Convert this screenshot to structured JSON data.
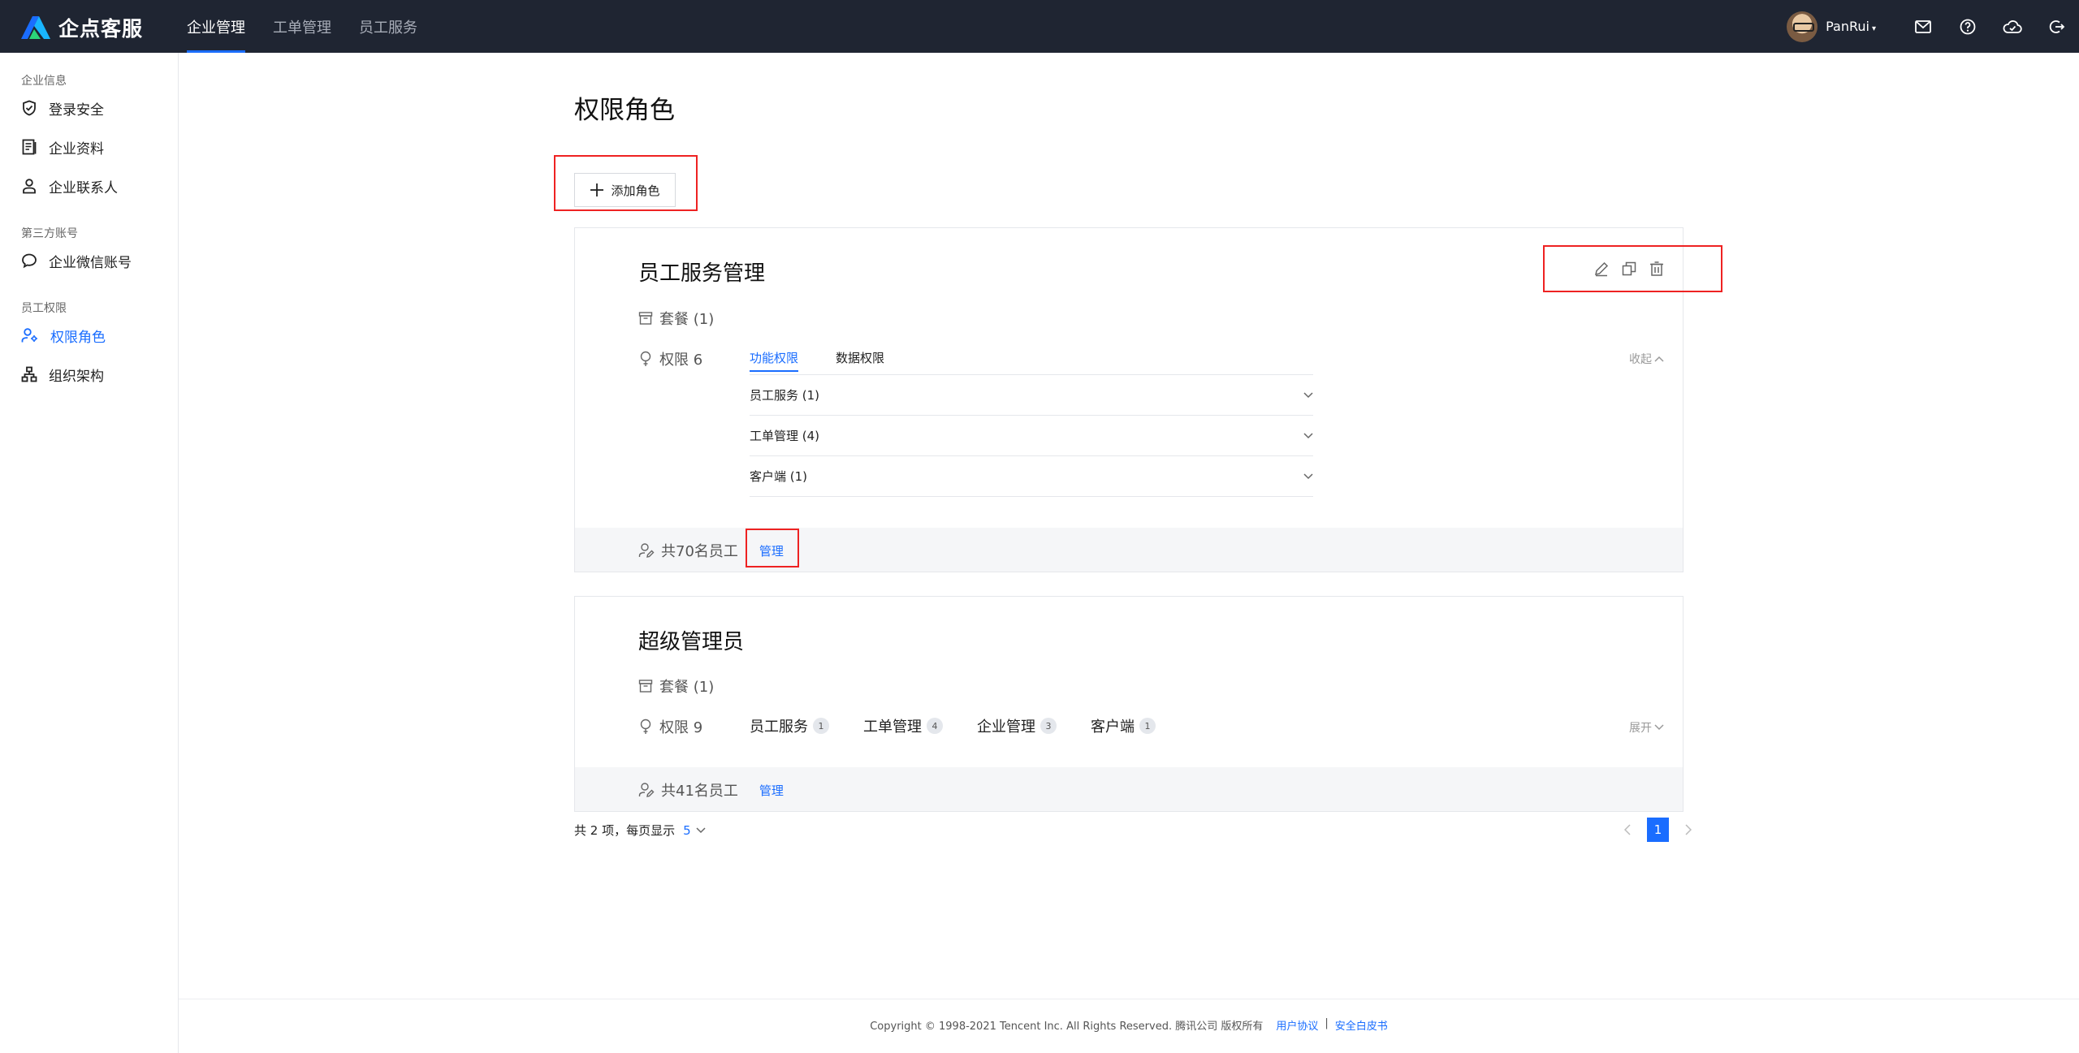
{
  "brand": {
    "name": "企点客服"
  },
  "top_nav": [
    {
      "label": "企业管理",
      "active": true
    },
    {
      "label": "工单管理",
      "active": false
    },
    {
      "label": "员工服务",
      "active": false
    }
  ],
  "user": {
    "name": "PanRui",
    "caret": "▾"
  },
  "top_icons": [
    "mail-icon",
    "help-icon",
    "cloud-icon",
    "logout-icon"
  ],
  "sidebar": {
    "groups": [
      {
        "title": "企业信息",
        "items": [
          {
            "label": "登录安全",
            "icon": "shield-icon"
          },
          {
            "label": "企业资料",
            "icon": "document-icon"
          },
          {
            "label": "企业联系人",
            "icon": "contact-icon"
          }
        ]
      },
      {
        "title": "第三方账号",
        "items": [
          {
            "label": "企业微信账号",
            "icon": "wechat-icon"
          }
        ]
      },
      {
        "title": "员工权限",
        "items": [
          {
            "label": "权限角色",
            "icon": "role-icon",
            "active": true
          },
          {
            "label": "组织架构",
            "icon": "org-chart-icon"
          }
        ]
      }
    ]
  },
  "main": {
    "title": "权限角色",
    "add_button": "添加角色",
    "roles": [
      {
        "name": "员工服务管理",
        "package": "套餐 (1)",
        "permission": "权限 6",
        "tabs": [
          "功能权限",
          "数据权限"
        ],
        "collapse_label": "收起",
        "accordion": [
          "员工服务 (1)",
          "工单管理 (4)",
          "客户端 (1)"
        ],
        "employees": "共70名员工",
        "manage": "管理"
      },
      {
        "name": "超级管理员",
        "package": "套餐 (1)",
        "permission": "权限 9",
        "chips": [
          {
            "label": "员工服务",
            "count": "1"
          },
          {
            "label": "工单管理",
            "count": "4"
          },
          {
            "label": "企业管理",
            "count": "3"
          },
          {
            "label": "客户端",
            "count": "1"
          }
        ],
        "expand_label": "展开",
        "employees": "共41名员工",
        "manage": "管理"
      }
    ],
    "pagination": {
      "summary": "共 2 项，每页显示",
      "page_size": "5",
      "current_page": "1"
    }
  },
  "footer": {
    "copyright": "Copyright © 1998-2021 Tencent Inc. All Rights Reserved. 腾讯公司 版权所有",
    "links": [
      "用户协议",
      "安全白皮书"
    ],
    "separator": "|"
  },
  "colors": {
    "accent": "#1a6dff",
    "topbar": "#1f2532",
    "highlight": "#e22222"
  }
}
